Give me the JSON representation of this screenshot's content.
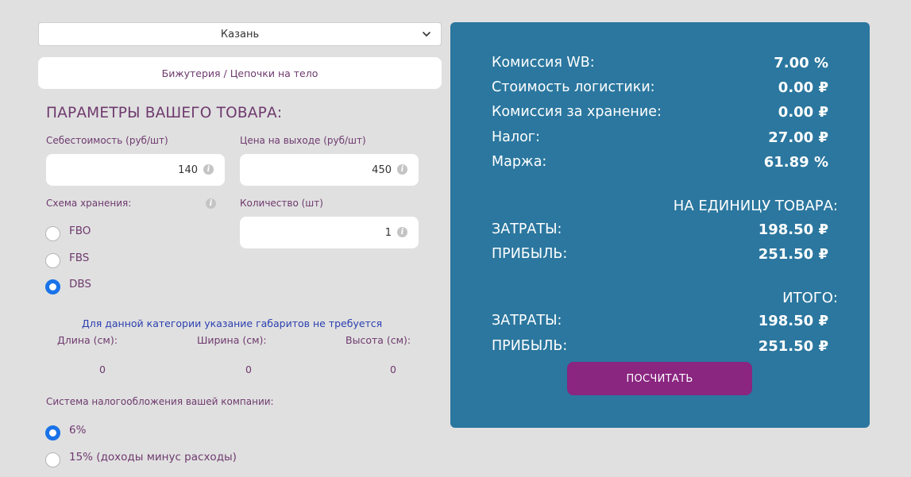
{
  "city_select": {
    "value": "Казань"
  },
  "category": {
    "value": "Бижутерия / Цепочки на тело"
  },
  "params": {
    "title": "ПАРАМЕТРЫ ВАШЕГО ТОВАРА:",
    "cost_label": "Себестоимость (руб/шт)",
    "cost_value": "140",
    "price_label": "Цена на выходе (руб/шт)",
    "price_value": "450",
    "storage_label": "Схема хранения:",
    "quantity_label": "Количество (шт)",
    "quantity_value": "1",
    "storage_options": [
      {
        "label": "FBO",
        "checked": false
      },
      {
        "label": "FBS",
        "checked": false
      },
      {
        "label": "DBS",
        "checked": true
      }
    ]
  },
  "dimensions": {
    "note": "Для данной категории указание габаритов не требуется",
    "length_label": "Длина (см):",
    "width_label": "Ширина (см):",
    "height_label": "Высота (см):",
    "length_value": "0",
    "width_value": "0",
    "height_value": "0"
  },
  "tax": {
    "label": "Система налогообложения вашей компании:",
    "options": [
      {
        "label": "6%",
        "checked": true
      },
      {
        "label": "15% (доходы минус расходы)",
        "checked": false
      }
    ]
  },
  "results": {
    "commission_label": "Комиссия WB:",
    "commission_value": "7.00 %",
    "logistics_label": "Стоимость логистики:",
    "logistics_value": "0.00 ₽",
    "storage_fee_label": "Комиссия за хранение:",
    "storage_fee_value": "0.00 ₽",
    "tax_label": "Налог:",
    "tax_value": "27.00 ₽",
    "margin_label": "Маржа:",
    "margin_value": "61.89 %",
    "per_unit_heading": "НА ЕДИНИЦУ ТОВАРА:",
    "unit_costs_label": "ЗАТРАТЫ:",
    "unit_costs_value": "198.50 ₽",
    "unit_profit_label": "ПРИБЫЛЬ:",
    "unit_profit_value": "251.50 ₽",
    "total_heading": "ИТОГО:",
    "total_costs_label": "ЗАТРАТЫ:",
    "total_costs_value": "198.50 ₽",
    "total_profit_label": "ПРИБЫЛЬ:",
    "total_profit_value": "251.50 ₽"
  },
  "calculate_button": {
    "label": "ПОСЧИТАТЬ"
  },
  "colors": {
    "background": "#e0e0e0",
    "panel": "#2b779f",
    "button": "#8a2580",
    "text": "#6e3a6e",
    "radio_checked": "#1a73e8",
    "note": "#2a3fb0"
  },
  "icons": [
    "chevron-down-icon",
    "info-icon"
  ]
}
